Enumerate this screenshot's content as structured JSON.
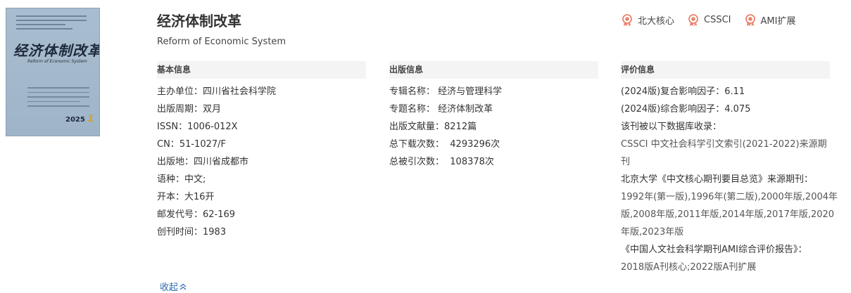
{
  "journal": {
    "title": "经济体制改革",
    "subtitle": "Reform of Economic System"
  },
  "cover": {
    "calligraphy": "经济体制改革",
    "english": "Reform of Economic System",
    "year": "2025",
    "issue": "1"
  },
  "badges": [
    {
      "label": "北大核心",
      "icon": "award-ribbon-icon"
    },
    {
      "label": "CSSCI",
      "icon": "award-ribbon-icon"
    },
    {
      "label": "AMI扩展",
      "icon": "award-ribbon-icon"
    }
  ],
  "basic": {
    "heading": "基本信息",
    "rows": [
      {
        "key": "主办单位：",
        "value": "四川省社会科学院"
      },
      {
        "key": "出版周期：",
        "value": "双月"
      },
      {
        "key": "ISSN：",
        "value": "1006-012X"
      },
      {
        "key": "CN：",
        "value": "51-1027/F"
      },
      {
        "key": "出版地：",
        "value": "四川省成都市"
      },
      {
        "key": "语种：",
        "value": "中文;"
      },
      {
        "key": "开本：",
        "value": "大16开"
      },
      {
        "key": "邮发代号：",
        "value": "62-169"
      },
      {
        "key": "创刊时间：",
        "value": "1983"
      }
    ]
  },
  "publish": {
    "heading": "出版信息",
    "rows": [
      {
        "key": "专辑名称：",
        "value": "经济与管理科学"
      },
      {
        "key": "专题名称：",
        "value": "经济体制改革"
      },
      {
        "key": "出版文献量：",
        "value": "8212篇"
      },
      {
        "key": "总下载次数：",
        "value": "4293296次"
      },
      {
        "key": "总被引次数：",
        "value": "108378次"
      }
    ]
  },
  "evaluation": {
    "heading": "评价信息",
    "lines": [
      "(2024版)复合影响因子：6.11",
      "(2024版)综合影响因子：4.075",
      "该刊被以下数据库收录：",
      "CSSCI 中文社会科学引文索引(2021-2022)来源期",
      "刊",
      "北京大学《中文核心期刊要目总览》来源期刊：",
      "1992年(第一版),1996年(第二版),2000年版,2004年",
      "版,2008年版,2011年版,2014年版,2017年版,2020",
      "年版,2023年版",
      "《中国人文社会科学期刊AMI综合评价报告》：",
      "2018版A刊核心;2022版A刊扩展"
    ]
  },
  "collapse_label": "收起"
}
